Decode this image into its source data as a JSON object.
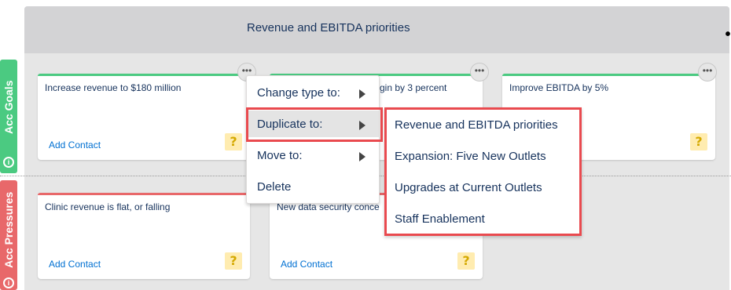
{
  "board": {
    "title": "Revenue and EBITDA priorities",
    "menu_icon": "more-horizontal-icon",
    "menu_glyph": "•••"
  },
  "lanes": [
    {
      "label": "Acc Goals",
      "color": "#4bca81",
      "info_glyph": "i"
    },
    {
      "label": "Acc Pressures",
      "color": "#e8686a",
      "info_glyph": "i"
    }
  ],
  "cards": {
    "goal1": {
      "text": "Increase revenue to $180 million",
      "link": "Add Contact",
      "badge": "?"
    },
    "goal2": {
      "text": "gin by 3 percent"
    },
    "goal3": {
      "text": "Improve EBITDA by 5%",
      "badge": "?"
    },
    "press1": {
      "text": "Clinic revenue is flat, or falling",
      "link": "Add Contact",
      "badge": "?"
    },
    "press2": {
      "text": "New data security conce",
      "link": "Add Contact",
      "badge": "?"
    },
    "dots_glyph": "•••"
  },
  "context_menu": {
    "items": [
      {
        "label": "Change type to:"
      },
      {
        "label": "Duplicate to:"
      },
      {
        "label": "Move to:"
      },
      {
        "label": "Delete"
      }
    ]
  },
  "submenu": {
    "items": [
      "Revenue and EBITDA priorities",
      "Expansion: Five New Outlets",
      "Upgrades at Current Outlets",
      "Staff Enablement"
    ]
  },
  "colors": {
    "highlight": "#e94a4f",
    "link": "#0070d2",
    "text": "#16325c"
  }
}
